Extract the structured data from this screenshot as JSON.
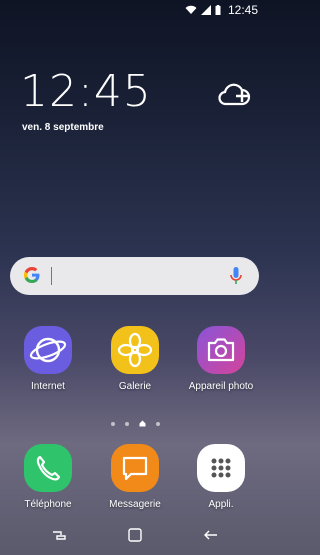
{
  "status": {
    "time": "12:45"
  },
  "clock": {
    "time": "12:45",
    "date": "ven. 8 septembre"
  },
  "search": {
    "placeholder": ""
  },
  "apps_row1": [
    {
      "label": "Internet",
      "icon": "internet-icon",
      "color": "#6a5de0"
    },
    {
      "label": "Galerie",
      "icon": "gallery-flower-icon",
      "color": "#f3c21a"
    },
    {
      "label": "Appareil photo",
      "icon": "camera-icon",
      "color": "#c543a0"
    }
  ],
  "dock": [
    {
      "label": "Téléphone",
      "icon": "phone-icon",
      "color": "#2fc36b"
    },
    {
      "label": "Messagerie",
      "icon": "message-icon",
      "color": "#f28a1a"
    },
    {
      "label": "Appli.",
      "icon": "apps-grid-icon",
      "color": "#ffffff"
    }
  ],
  "page_indicator": {
    "pages": 4,
    "current": "home"
  },
  "nav": [
    "recent-apps-icon",
    "home-icon",
    "back-icon"
  ]
}
